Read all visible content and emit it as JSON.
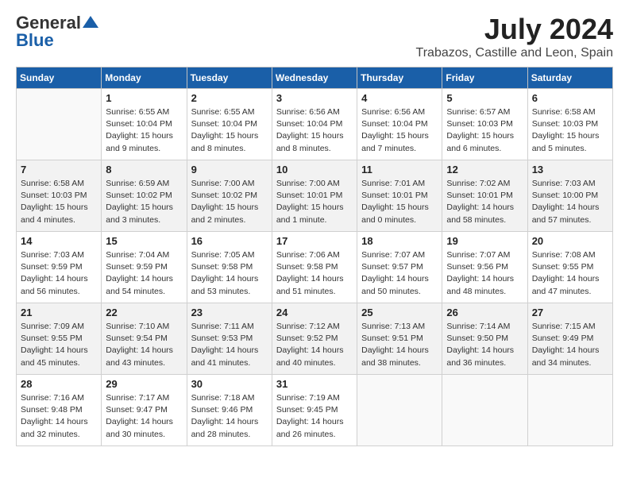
{
  "logo": {
    "general": "General",
    "blue": "Blue"
  },
  "title": {
    "month_year": "July 2024",
    "location": "Trabazos, Castille and Leon, Spain"
  },
  "weekdays": [
    "Sunday",
    "Monday",
    "Tuesday",
    "Wednesday",
    "Thursday",
    "Friday",
    "Saturday"
  ],
  "weeks": [
    [
      {
        "day": "",
        "info": ""
      },
      {
        "day": "1",
        "info": "Sunrise: 6:55 AM\nSunset: 10:04 PM\nDaylight: 15 hours\nand 9 minutes."
      },
      {
        "day": "2",
        "info": "Sunrise: 6:55 AM\nSunset: 10:04 PM\nDaylight: 15 hours\nand 8 minutes."
      },
      {
        "day": "3",
        "info": "Sunrise: 6:56 AM\nSunset: 10:04 PM\nDaylight: 15 hours\nand 8 minutes."
      },
      {
        "day": "4",
        "info": "Sunrise: 6:56 AM\nSunset: 10:04 PM\nDaylight: 15 hours\nand 7 minutes."
      },
      {
        "day": "5",
        "info": "Sunrise: 6:57 AM\nSunset: 10:03 PM\nDaylight: 15 hours\nand 6 minutes."
      },
      {
        "day": "6",
        "info": "Sunrise: 6:58 AM\nSunset: 10:03 PM\nDaylight: 15 hours\nand 5 minutes."
      }
    ],
    [
      {
        "day": "7",
        "info": "Sunrise: 6:58 AM\nSunset: 10:03 PM\nDaylight: 15 hours\nand 4 minutes."
      },
      {
        "day": "8",
        "info": "Sunrise: 6:59 AM\nSunset: 10:02 PM\nDaylight: 15 hours\nand 3 minutes."
      },
      {
        "day": "9",
        "info": "Sunrise: 7:00 AM\nSunset: 10:02 PM\nDaylight: 15 hours\nand 2 minutes."
      },
      {
        "day": "10",
        "info": "Sunrise: 7:00 AM\nSunset: 10:01 PM\nDaylight: 15 hours\nand 1 minute."
      },
      {
        "day": "11",
        "info": "Sunrise: 7:01 AM\nSunset: 10:01 PM\nDaylight: 15 hours\nand 0 minutes."
      },
      {
        "day": "12",
        "info": "Sunrise: 7:02 AM\nSunset: 10:01 PM\nDaylight: 14 hours\nand 58 minutes."
      },
      {
        "day": "13",
        "info": "Sunrise: 7:03 AM\nSunset: 10:00 PM\nDaylight: 14 hours\nand 57 minutes."
      }
    ],
    [
      {
        "day": "14",
        "info": "Sunrise: 7:03 AM\nSunset: 9:59 PM\nDaylight: 14 hours\nand 56 minutes."
      },
      {
        "day": "15",
        "info": "Sunrise: 7:04 AM\nSunset: 9:59 PM\nDaylight: 14 hours\nand 54 minutes."
      },
      {
        "day": "16",
        "info": "Sunrise: 7:05 AM\nSunset: 9:58 PM\nDaylight: 14 hours\nand 53 minutes."
      },
      {
        "day": "17",
        "info": "Sunrise: 7:06 AM\nSunset: 9:58 PM\nDaylight: 14 hours\nand 51 minutes."
      },
      {
        "day": "18",
        "info": "Sunrise: 7:07 AM\nSunset: 9:57 PM\nDaylight: 14 hours\nand 50 minutes."
      },
      {
        "day": "19",
        "info": "Sunrise: 7:07 AM\nSunset: 9:56 PM\nDaylight: 14 hours\nand 48 minutes."
      },
      {
        "day": "20",
        "info": "Sunrise: 7:08 AM\nSunset: 9:55 PM\nDaylight: 14 hours\nand 47 minutes."
      }
    ],
    [
      {
        "day": "21",
        "info": "Sunrise: 7:09 AM\nSunset: 9:55 PM\nDaylight: 14 hours\nand 45 minutes."
      },
      {
        "day": "22",
        "info": "Sunrise: 7:10 AM\nSunset: 9:54 PM\nDaylight: 14 hours\nand 43 minutes."
      },
      {
        "day": "23",
        "info": "Sunrise: 7:11 AM\nSunset: 9:53 PM\nDaylight: 14 hours\nand 41 minutes."
      },
      {
        "day": "24",
        "info": "Sunrise: 7:12 AM\nSunset: 9:52 PM\nDaylight: 14 hours\nand 40 minutes."
      },
      {
        "day": "25",
        "info": "Sunrise: 7:13 AM\nSunset: 9:51 PM\nDaylight: 14 hours\nand 38 minutes."
      },
      {
        "day": "26",
        "info": "Sunrise: 7:14 AM\nSunset: 9:50 PM\nDaylight: 14 hours\nand 36 minutes."
      },
      {
        "day": "27",
        "info": "Sunrise: 7:15 AM\nSunset: 9:49 PM\nDaylight: 14 hours\nand 34 minutes."
      }
    ],
    [
      {
        "day": "28",
        "info": "Sunrise: 7:16 AM\nSunset: 9:48 PM\nDaylight: 14 hours\nand 32 minutes."
      },
      {
        "day": "29",
        "info": "Sunrise: 7:17 AM\nSunset: 9:47 PM\nDaylight: 14 hours\nand 30 minutes."
      },
      {
        "day": "30",
        "info": "Sunrise: 7:18 AM\nSunset: 9:46 PM\nDaylight: 14 hours\nand 28 minutes."
      },
      {
        "day": "31",
        "info": "Sunrise: 7:19 AM\nSunset: 9:45 PM\nDaylight: 14 hours\nand 26 minutes."
      },
      {
        "day": "",
        "info": ""
      },
      {
        "day": "",
        "info": ""
      },
      {
        "day": "",
        "info": ""
      }
    ]
  ]
}
